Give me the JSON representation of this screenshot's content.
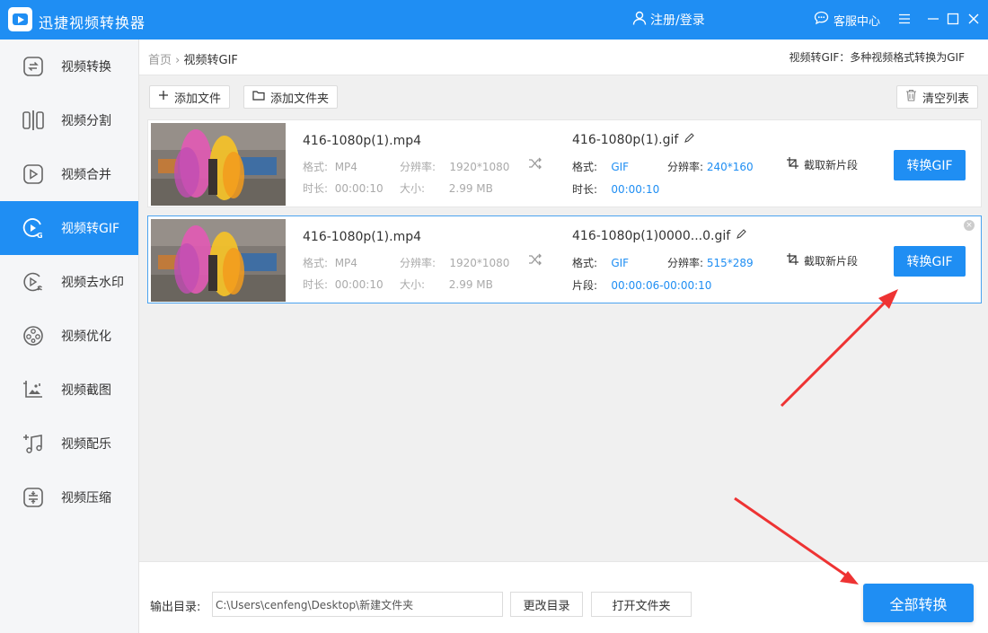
{
  "app": {
    "title": "迅捷视频转换器"
  },
  "titlebar": {
    "login": "注册/登录",
    "service": "客服中心"
  },
  "sidebar": {
    "items": [
      {
        "label": "视频转换",
        "icon": "convert-icon"
      },
      {
        "label": "视频分割",
        "icon": "split-icon"
      },
      {
        "label": "视频合并",
        "icon": "merge-icon"
      },
      {
        "label": "视频转GIF",
        "icon": "gif-icon",
        "active": true
      },
      {
        "label": "视频去水印",
        "icon": "watermark-icon"
      },
      {
        "label": "视频优化",
        "icon": "optimize-icon"
      },
      {
        "label": "视频截图",
        "icon": "screenshot-icon"
      },
      {
        "label": "视频配乐",
        "icon": "music-icon"
      },
      {
        "label": "视频压缩",
        "icon": "compress-icon"
      }
    ]
  },
  "breadcrumb": {
    "home": "首页",
    "sep": "›",
    "current": "视频转GIF"
  },
  "header_desc": "视频转GIF：多种视频格式转换为GIF",
  "toolbar": {
    "add_file": "添加文件",
    "add_folder": "添加文件夹",
    "clear_list": "清空列表"
  },
  "labels": {
    "format": "格式:",
    "resolution": "分辨率:",
    "duration": "时长:",
    "size": "大小:",
    "clip": "片段:",
    "cut_segment": "截取新片段",
    "convert_gif": "转换GIF"
  },
  "files": [
    {
      "name": "416-1080p(1).mp4",
      "format": "MP4",
      "resolution": "1920*1080",
      "duration": "00:00:10",
      "size": "2.99 MB",
      "output_name": "416-1080p(1).gif",
      "output_format": "GIF",
      "output_resolution": "240*160",
      "output_time_label": "时长:",
      "output_time": "00:00:10"
    },
    {
      "name": "416-1080p(1).mp4",
      "format": "MP4",
      "resolution": "1920*1080",
      "duration": "00:00:10",
      "size": "2.99 MB",
      "output_name": "416-1080p(1)0000...0.gif",
      "output_format": "GIF",
      "output_resolution": "515*289",
      "output_time_label": "片段:",
      "output_time": "00:00:06-00:00:10"
    }
  ],
  "bottom": {
    "output_label": "输出目录:",
    "output_path": "C:\\Users\\cenfeng\\Desktop\\新建文件夹",
    "change_dir": "更改目录",
    "open_folder": "打开文件夹",
    "convert_all": "全部转换"
  },
  "colors": {
    "accent": "#1f8ef3",
    "arrow": "#ee3333"
  }
}
